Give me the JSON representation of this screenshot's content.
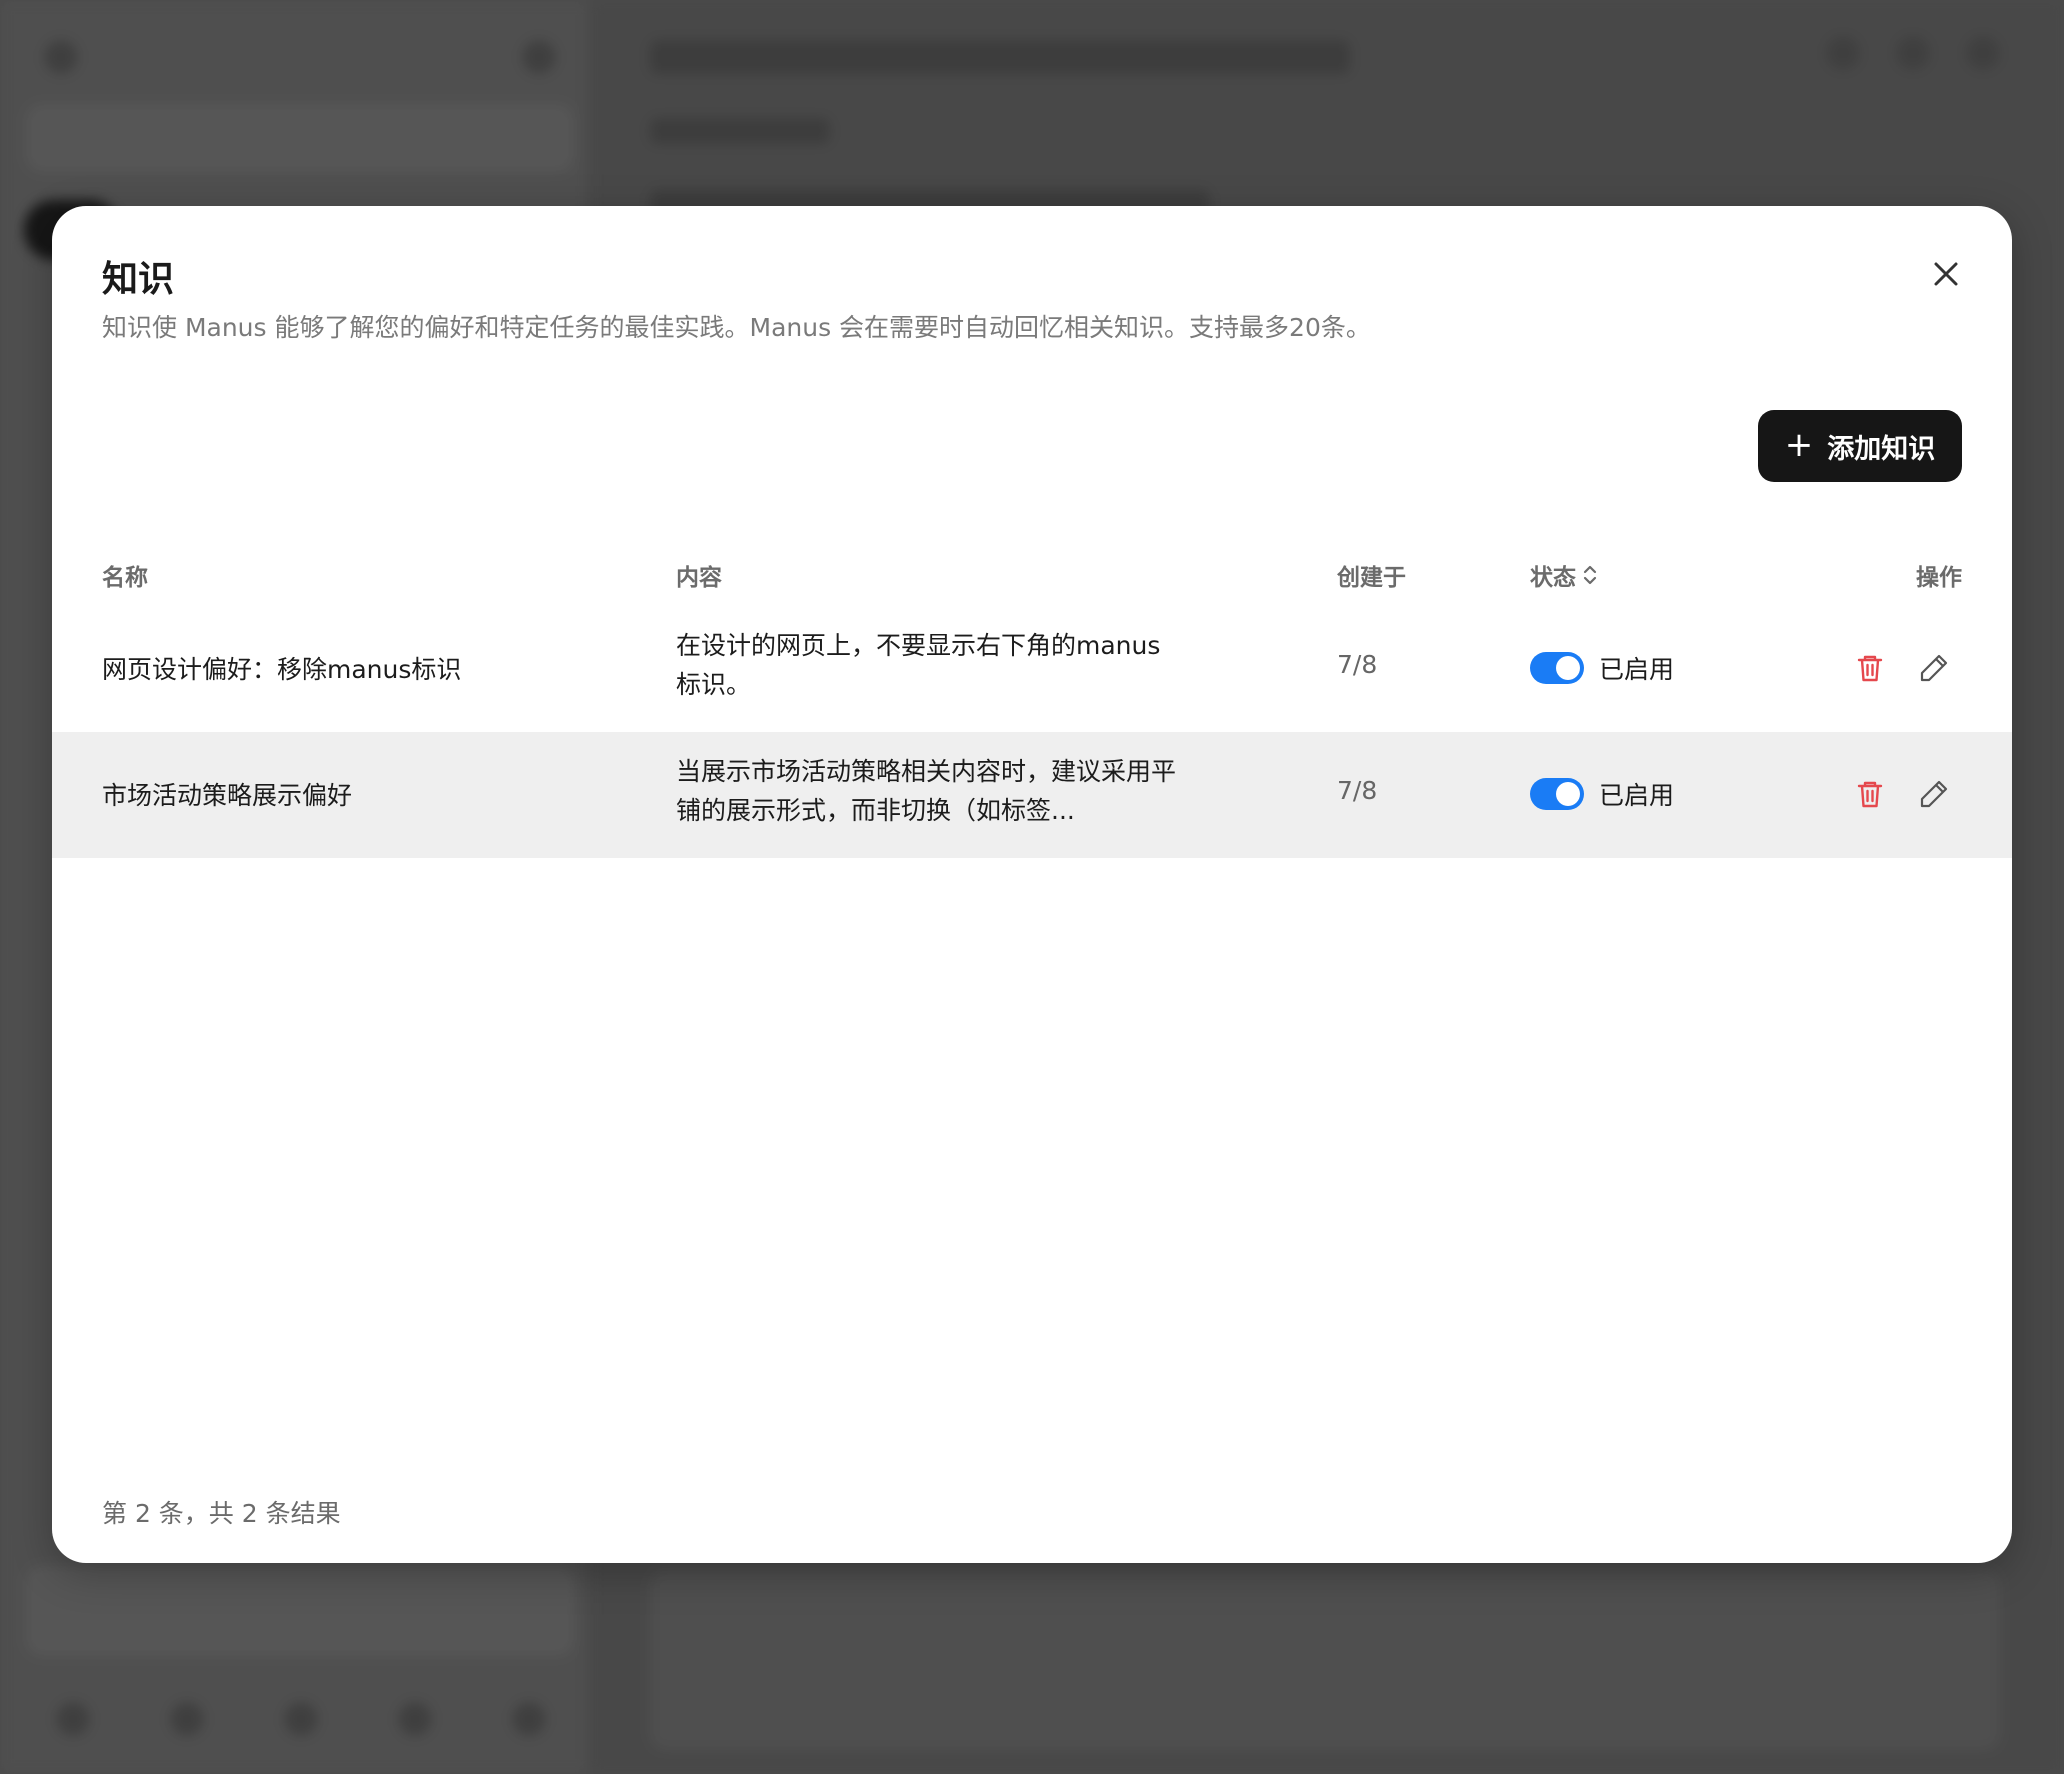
{
  "modal": {
    "title": "知识",
    "description": "知识使 Manus 能够了解您的偏好和特定任务的最佳实践。Manus 会在需要时自动回忆相关知识。支持最多20条。",
    "add_button": "添加知识",
    "footer": "第 2 条，共 2 条结果"
  },
  "table": {
    "headers": {
      "name": "名称",
      "content": "内容",
      "created": "创建于",
      "status": "状态",
      "actions": "操作"
    },
    "rows": [
      {
        "name": "网页设计偏好：移除manus标识",
        "content": "在设计的网页上，不要显示右下角的manus标识。",
        "created": "7/8",
        "status": "已启用",
        "enabled": true
      },
      {
        "name": "市场活动策略展示偏好",
        "content": "当展示市场活动策略相关内容时，建议采用平铺的展示形式，而非切换（如标签...",
        "created": "7/8",
        "status": "已启用",
        "enabled": true
      }
    ]
  },
  "colors": {
    "toggle_on": "#1a7cf5",
    "delete": "#e5484d",
    "primary_button": "#161616"
  },
  "icons": {
    "close": "close-icon",
    "add": "plus-icon",
    "sort": "sort-icon",
    "delete": "trash-icon",
    "edit": "pencil-icon"
  }
}
